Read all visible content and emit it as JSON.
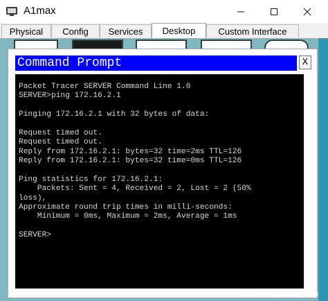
{
  "window": {
    "title": "A1max",
    "icon": "packet-tracer-server-icon"
  },
  "tabs": [
    {
      "label": "Physical",
      "active": false
    },
    {
      "label": "Config",
      "active": false
    },
    {
      "label": "Services",
      "active": false
    },
    {
      "label": "Desktop",
      "active": true
    },
    {
      "label": "Custom Interface",
      "active": false
    }
  ],
  "command_prompt": {
    "title": "Command Prompt",
    "close_label": "X",
    "lines": [
      "Packet Tracer SERVER Command Line 1.0",
      "SERVER>ping 172.16.2.1",
      "",
      "Pinging 172.16.2.1 with 32 bytes of data:",
      "",
      "Request timed out.",
      "Request timed out.",
      "Reply from 172.16.2.1: bytes=32 time=2ms TTL=126",
      "Reply from 172.16.2.1: bytes=32 time=0ms TTL=126",
      "",
      "Ping statistics for 172.16.2.1:",
      "    Packets: Sent = 4, Received = 2, Lost = 2 (50%",
      "loss),",
      "Approximate round trip times in milli-seconds:",
      "    Minimum = 0ms, Maximum = 2ms, Average = 1ms",
      "",
      "SERVER>"
    ]
  },
  "watermark": "CSDN @biyezuopinvip",
  "colors": {
    "desktop_bg": "#7fb6c0",
    "cmd_title_bg": "#0000ff",
    "terminal_bg": "#000000",
    "terminal_text": "#d7d7d7"
  }
}
